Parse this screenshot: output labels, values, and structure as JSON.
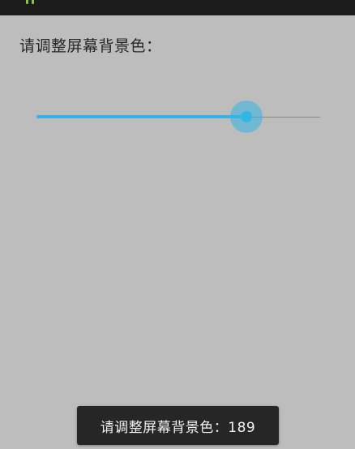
{
  "prompt": {
    "label": "请调整屏幕背景色："
  },
  "seekbar": {
    "value": 189,
    "max": 255,
    "accent_color": "#33b5e5"
  },
  "toast": {
    "text": "请调整屏幕背景色：189"
  },
  "status_bar": {
    "icon": "android-notification-icon"
  }
}
